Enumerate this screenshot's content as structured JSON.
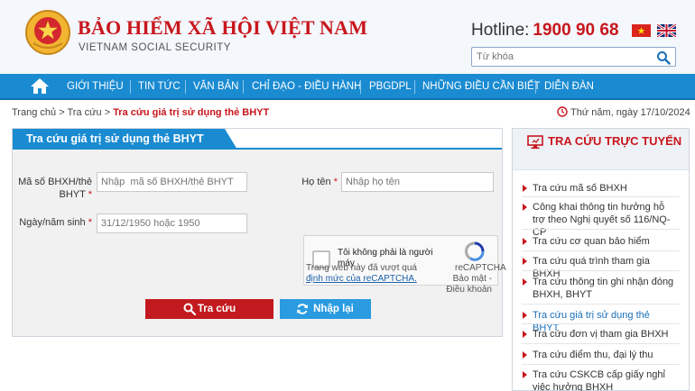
{
  "header": {
    "title": "BẢO HIỂM XÃ HỘI VIỆT NAM",
    "subtitle": "VIETNAM SOCIAL SECURITY",
    "hotline_label": "Hotline:",
    "hotline_number": "1900 90 68",
    "search_placeholder": "Từ khóa",
    "icons": [
      "emblem-icon",
      "vietnam-flag-icon",
      "uk-flag-icon",
      "search-icon"
    ]
  },
  "nav": {
    "items": [
      "GIỚI THIỆU",
      "TIN TỨC",
      "VĂN BẢN",
      "CHỈ ĐẠO - ĐIỀU HÀNH",
      "PBGDPL",
      "NHỮNG ĐIỀU CẦN BIẾT",
      "DIỄN ĐÀN"
    ]
  },
  "breadcrumb": {
    "home": "Trang chủ",
    "sep": ">",
    "lookup": "Tra cứu",
    "current": "Tra cứu giá trị sử dụng thẻ BHYT"
  },
  "date_text": "Thứ năm, ngày 17/10/2024",
  "form": {
    "title": "Tra cứu giá trị sử dụng thẻ BHYT",
    "code_label": "Mã số BHXH/thẻ BHYT",
    "code_placeholder": "Nhập  mã số BHXH/thẻ BHYT",
    "name_label": "Họ tên",
    "name_placeholder": "Nhập họ tên",
    "dob_label": "Ngày/năm sinh",
    "dob_placeholder": "31/12/1950 hoặc 1950",
    "required_mark": "*",
    "captcha": {
      "text": "Tôi không phải là người máy",
      "brand": "reCAPTCHA",
      "privacy": "Bảo mật - Điều khoản",
      "overflow_text": "Trang web này đã vượt quá",
      "overflow_link": "định mức của reCAPTCHA."
    },
    "search_button": "Tra cứu",
    "reset_button": "Nhập lại"
  },
  "sidebar": {
    "title": "TRA CỨU TRỰC TUYẾN",
    "items": [
      "Tra cứu mã số BHXH",
      "Công khai thông tin hưởng hỗ trợ theo Nghị quyết số 116/NQ-CP",
      "Tra cứu cơ quan bảo hiểm",
      "Tra cứu quá trình tham gia BHXH",
      "Tra cứu thông tin ghi nhận đóng BHXH, BHYT",
      "Tra cứu giá trị sử dụng thẻ BHYT",
      "Tra cứu đơn vị tham gia BHXH",
      "Tra cứu điểm thu, đại lý thu",
      "Tra cứu CSKCB cấp giấy nghỉ việc hưởng BHXH"
    ],
    "active_index": 5
  },
  "colors": {
    "brand_red": "#c8161d",
    "nav_blue": "#1a8bd1",
    "reset_blue": "#2a9be0"
  }
}
